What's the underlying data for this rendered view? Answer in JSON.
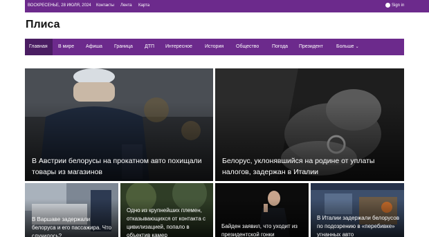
{
  "topbar": {
    "date": "Воскресенье, 28 июля, 2024",
    "links": [
      "Контакты",
      "Лента",
      "Карта"
    ],
    "signin": "Sign in"
  },
  "logo": "Плиса",
  "nav": {
    "items": [
      "Главная",
      "В мире",
      "Афиша",
      "Граница",
      "ДТП",
      "Интересное",
      "История",
      "Общество",
      "Погода",
      "Президент",
      "Больше"
    ],
    "active": "Главная",
    "more_chevron": "⌄"
  },
  "articles": {
    "big": [
      {
        "title": "В Австрии белорусы на прокатном авто похищали товары из магазинов"
      },
      {
        "title": "Белорус, уклонявшийся на родине от уплаты налогов, задержан в Италии"
      }
    ],
    "small": [
      {
        "title": "В Варшаве задержали белоруса и его пассажира. Что случилось?"
      },
      {
        "title": "Одно из крупнейших племен, отказывающихся от контакта с цивилизацией, попало в объектив камер"
      },
      {
        "title": "Байден заявил, что уходит из президентской гонки"
      },
      {
        "title": "В Италии задержали белорусов по подозрению в «перебивке» угнанных авто"
      }
    ]
  },
  "colors": {
    "brand": "#6c2a8c",
    "nav_active": "#4a1d62"
  }
}
